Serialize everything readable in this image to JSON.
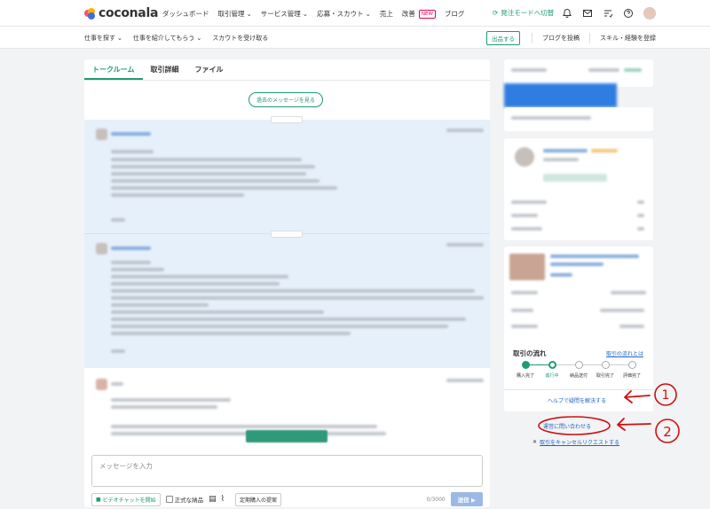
{
  "header": {
    "brand": "coconala",
    "nav": [
      {
        "label": "ダッシュボード",
        "dropdown": false
      },
      {
        "label": "取引管理",
        "dropdown": true
      },
      {
        "label": "サービス管理",
        "dropdown": true
      },
      {
        "label": "応募・スカウト",
        "dropdown": true
      },
      {
        "label": "売上",
        "dropdown": false
      },
      {
        "label": "改善",
        "dropdown": false,
        "badge": "NEW"
      },
      {
        "label": "ブログ",
        "dropdown": false
      }
    ],
    "mode_switch": "発注モードへ切替",
    "icons": [
      "bell-icon",
      "mail-icon",
      "checklist-icon",
      "help-icon",
      "avatar"
    ]
  },
  "subnav": {
    "items": [
      {
        "label": "仕事を探す"
      },
      {
        "label": "仕事を紹介してもらう"
      },
      {
        "label": "スカウトを受け取る"
      }
    ],
    "publish_button": "出品する",
    "blog_post": "ブログを投稿",
    "skill_register": "スキル・経験を登録"
  },
  "talk": {
    "tabs": [
      "トークルーム",
      "取引詳細",
      "ファイル"
    ],
    "active_tab": 0,
    "past_messages_button": "過去のメッセージを見る",
    "input_placeholder": "メッセージを入力",
    "video_chat_button": "ビデオチャットを開始",
    "official_delivery_label": "正式な納品",
    "regular_purchase_button": "定期購入の提案",
    "char_counter": "0/3000",
    "send_button": "送信 ▶"
  },
  "sidebar": {
    "flow_title": "取引の流れ",
    "flow_link": "取引の流れとは",
    "steps": [
      "購入完了",
      "進行中",
      "納品送付",
      "取引完了",
      "評価完了"
    ],
    "current_step": 1,
    "help_link": "ヘルプで疑問を解決する",
    "contact_button": "運営に問い合わせる",
    "cancel_request": "取引をキャンセルリクエストする"
  },
  "annotations": [
    "1",
    "2"
  ],
  "colors": {
    "accent": "#1f9b72",
    "link": "#1f63c4",
    "annotation": "#d01010"
  }
}
